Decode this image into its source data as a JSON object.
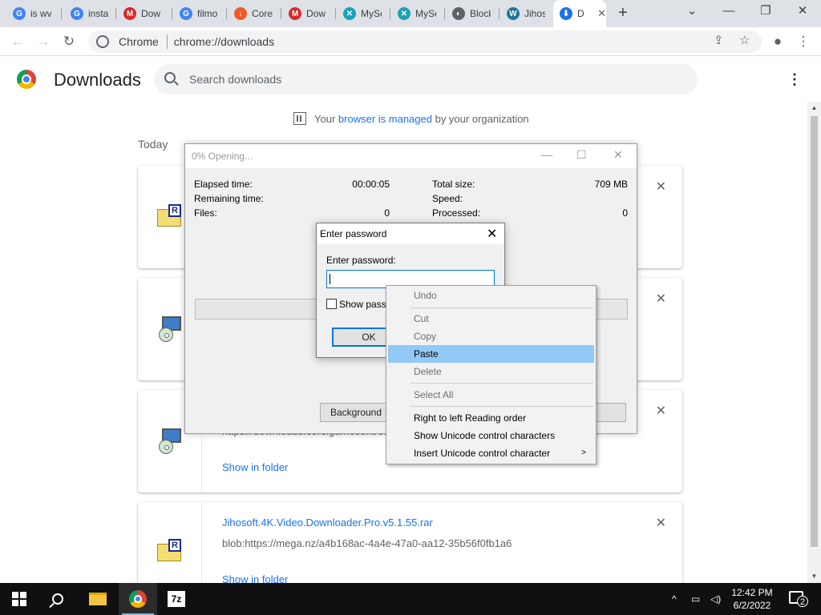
{
  "tabs": [
    {
      "title": "is wv",
      "favicon": "google-g",
      "color": "#4285f4",
      "glyph": "G"
    },
    {
      "title": "insta",
      "favicon": "google-g",
      "color": "#4285f4",
      "glyph": "G"
    },
    {
      "title": "Dow",
      "favicon": "mega",
      "color": "#d9272e",
      "glyph": "M"
    },
    {
      "title": "filmo",
      "favicon": "google-g",
      "color": "#4285f4",
      "glyph": "G"
    },
    {
      "title": "Corel",
      "favicon": "download-orange",
      "color": "#f05a28",
      "glyph": "↓"
    },
    {
      "title": "Dow",
      "favicon": "mega",
      "color": "#d9272e",
      "glyph": "M"
    },
    {
      "title": "MySe",
      "favicon": "mysearch",
      "color": "#1aa2b8",
      "glyph": "✕"
    },
    {
      "title": "MySe",
      "favicon": "mysearch",
      "color": "#1aa2b8",
      "glyph": "✕"
    },
    {
      "title": "Block",
      "favicon": "globe",
      "color": "#5f6368",
      "glyph": "◐"
    },
    {
      "title": "Jihos",
      "favicon": "wordpress",
      "color": "#21759b",
      "glyph": "W"
    },
    {
      "title": "D",
      "favicon": "download",
      "color": "#1a73e8",
      "glyph": "⬇",
      "active": true
    }
  ],
  "toolbar": {
    "site_chip": "Chrome",
    "url": "chrome://downloads"
  },
  "downloads_page": {
    "title": "Downloads",
    "search_placeholder": "Search downloads",
    "managed_prefix": "Your",
    "managed_link": "browser is managed",
    "managed_suffix": "by your organization",
    "section_label": "Today"
  },
  "download_items": [
    {
      "icon": "rar-icon",
      "filename": "",
      "url": "",
      "show_in_folder": ""
    },
    {
      "icon": "installer-icon",
      "filename": "",
      "url": "",
      "show_in_folder": ""
    },
    {
      "icon": "installer-icon",
      "filename": "",
      "url": "https://downloads.corelgamecontrol...",
      "show_in_folder": "Show in folder"
    },
    {
      "icon": "rar-icon",
      "filename": "Jihosoft.4K.Video.Downloader.Pro.v5.1.55.rar",
      "url": "blob:https://mega.nz/a4b168ac-4a4e-47a0-aa12-35b56f0fb1a6",
      "show_in_folder": "Show in folder"
    }
  ],
  "zip_window": {
    "title": "0% Opening...",
    "elapsed_label": "Elapsed time:",
    "elapsed_value": "00:00:05",
    "remaining_label": "Remaining time:",
    "files_label": "Files:",
    "files_value": "0",
    "total_size_label": "Total size:",
    "total_size_value": "709 MB",
    "speed_label": "Speed:",
    "processed_label": "Processed:",
    "processed_value": "0",
    "background_button": "Background"
  },
  "password_dialog": {
    "title": "Enter password",
    "field_label": "Enter password:",
    "show_password_label": "Show password",
    "ok_button": "OK"
  },
  "context_menu": {
    "undo": "Undo",
    "cut": "Cut",
    "copy": "Copy",
    "paste": "Paste",
    "delete": "Delete",
    "select_all": "Select All",
    "rtl": "Right to left Reading order",
    "show_unicode": "Show Unicode control characters",
    "insert_unicode": "Insert Unicode control character"
  },
  "taskbar": {
    "time": "12:42 PM",
    "date": "6/2/2022",
    "notifications": "2",
    "app_7z": "7z"
  }
}
